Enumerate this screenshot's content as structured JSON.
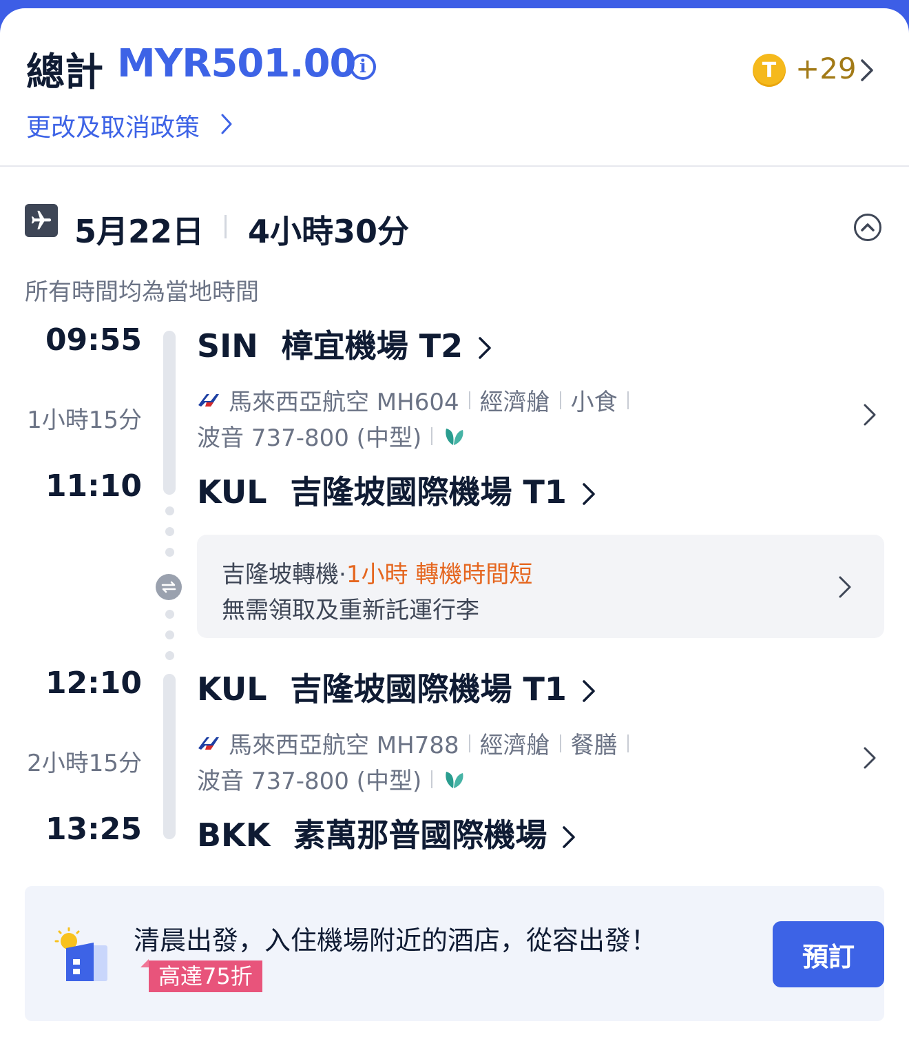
{
  "header": {
    "total_label": "總計",
    "total_price": "MYR501.00",
    "info_glyph": "i",
    "coin_glyph": "T",
    "points": "+29",
    "policy_link": "更改及取消政策"
  },
  "trip": {
    "date": "5月22日",
    "duration": "4小時30分",
    "local_time_note": "所有時間均為當地時間"
  },
  "segments": [
    {
      "dep_time": "09:55",
      "dep_code": "SIN",
      "dep_airport": "樟宜機場 T2",
      "duration": "1小時15分",
      "airline": "馬來西亞航空 MH604",
      "cabin": "經濟艙",
      "meal": "小食",
      "aircraft": "波音 737-800 (中型)",
      "arr_time": "11:10",
      "arr_code": "KUL",
      "arr_airport": "吉隆坡國際機場 T1"
    },
    {
      "dep_time": "12:10",
      "dep_code": "KUL",
      "dep_airport": "吉隆坡國際機場 T1",
      "duration": "2小時15分",
      "airline": "馬來西亞航空 MH788",
      "cabin": "經濟艙",
      "meal": "餐膳",
      "aircraft": "波音 737-800 (中型)",
      "arr_time": "13:25",
      "arr_code": "BKK",
      "arr_airport": "素萬那普國際機場"
    }
  ],
  "transfer": {
    "city": "吉隆坡轉機",
    "bullet": "·",
    "wait": "1小時",
    "warning": "轉機時間短",
    "baggage": "無需領取及重新託運行李"
  },
  "promo": {
    "text": "清晨出發，入住機場附近的酒店，從容出發！",
    "badge": "高達75折",
    "button": "預訂"
  },
  "icons": {
    "info": "info-icon",
    "coin": "coin-icon",
    "plane": "plane-icon",
    "collapse": "chevron-up-circle-icon",
    "transfer": "transfer-arrows-icon",
    "eco": "leaf-icon",
    "hotel": "hotel-building-sun-icon"
  },
  "colors": {
    "brand_blue": "#3d63e6",
    "warning_orange": "#e5661f",
    "points_gold": "#a27a17",
    "badge_pink": "#e8547b"
  }
}
